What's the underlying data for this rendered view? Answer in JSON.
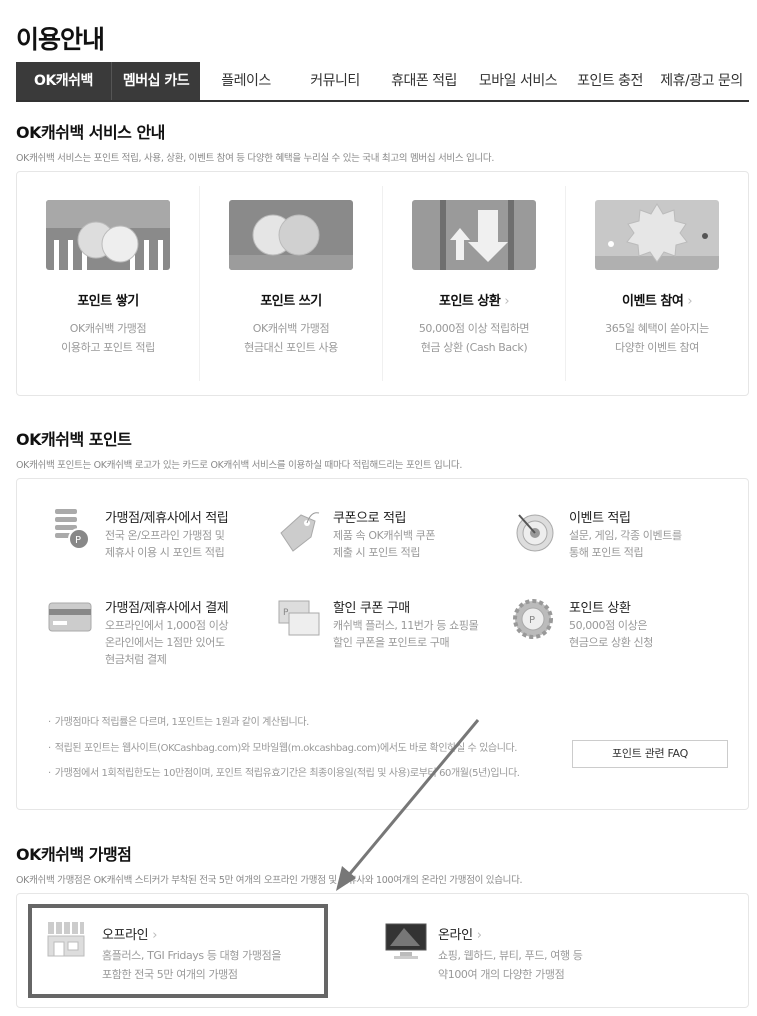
{
  "page": {
    "title": "이용안내"
  },
  "tabs": [
    {
      "label": "OK캐쉬백",
      "active": true
    },
    {
      "label": "멤버십 카드",
      "active": true
    },
    {
      "label": "플레이스",
      "active": false
    },
    {
      "label": "커뮤니티",
      "active": false
    },
    {
      "label": "휴대폰 적립",
      "active": false
    },
    {
      "label": "모바일 서비스",
      "active": false
    },
    {
      "label": "포인트 충전",
      "active": false
    },
    {
      "label": "제휴/광고 문의",
      "active": false
    }
  ],
  "service": {
    "title": "OK캐쉬백 서비스 안내",
    "desc": "OK캐쉬백 서비스는 포인트 적립, 사용, 상환, 이벤트 참여 등 다양한 혜택을 누리실 수 있는 국내 최고의 멤버십 서비스 입니다.",
    "cards": [
      {
        "name": "포인트 쌓기",
        "link": false,
        "line1": "OK캐쉬백 가맹점",
        "line2": "이용하고 포인트 적립",
        "icon": "coins-stack-icon"
      },
      {
        "name": "포인트 쓰기",
        "link": false,
        "line1": "OK캐쉬백 가맹점",
        "line2": "현금대신 포인트 사용",
        "icon": "coins-pair-icon"
      },
      {
        "name": "포인트 상환",
        "link": true,
        "line1": "50,000점 이상 적립하면",
        "line2": "현금 상환 (Cash Back)",
        "icon": "exchange-arrows-icon"
      },
      {
        "name": "이벤트 참여",
        "link": true,
        "line1": "365일 혜택이 쏟아지는",
        "line2": "다양한 이벤트 참여",
        "icon": "event-badge-icon"
      }
    ]
  },
  "points": {
    "title": "OK캐쉬백 포인트",
    "desc": "OK캐쉬백 포인트는 OK캐쉬백 로고가 있는 카드로 OK캐쉬백 서비스를 이용하실 때마다 적립해드리는 포인트 입니다.",
    "items": [
      {
        "title": "가맹점/제휴사에서 적립",
        "line1": "전국 온/오프라인 가맹점 및",
        "line2": "제휴사 이용 시 포인트 적립",
        "line3": "",
        "icon": "coin-stack-icon"
      },
      {
        "title": "쿠폰으로 적립",
        "line1": "제품 속 OK캐쉬백 쿠폰",
        "line2": "제출 시 포인트 적립",
        "line3": "",
        "icon": "coupon-tag-icon"
      },
      {
        "title": "이벤트 적립",
        "line1": "설문, 게임, 각종 이벤트를",
        "line2": "통해 포인트 적립",
        "line3": "",
        "icon": "target-icon"
      },
      {
        "title": "가맹점/제휴사에서 결제",
        "line1": "오프라인에서 1,000점 이상",
        "line2": "온라인에서는 1점만 있어도",
        "line3": "현금처럼 결제",
        "icon": "credit-card-icon"
      },
      {
        "title": "할인 쿠폰 구매",
        "line1": "캐쉬백 플러스, 11번가 등 쇼핑몰",
        "line2": "할인 쿠폰을 포인트로 구매",
        "line3": "",
        "icon": "discount-coupon-icon"
      },
      {
        "title": "포인트 상환",
        "line1": "50,000점 이상은",
        "line2": "현금으로 상환 신청",
        "line3": "",
        "icon": "point-gear-icon"
      }
    ],
    "notes": [
      "가맹점마다 적립률은 다르며, 1포인트는 1원과 같이 계산됩니다.",
      "적립된 포인트는 웹사이트(OKCashbag.com)와 모바일웹(m.okcashbag.com)에서도 바로 확인하실 수 있습니다.",
      "가맹점에서 1회적립한도는 10만점이며, 포인트 적립유효기간은 최종이용일(적립 및 사용)로부터 60개월(5년)입니다."
    ],
    "faq_label": "포인트 관련 FAQ"
  },
  "stores": {
    "title": "OK캐쉬백 가맹점",
    "desc": "OK캐쉬백 가맹점은 OK캐쉬백 스티커가 부착된 전국 5만 여개의 오프라인 가맹점 및 제휴사와 100여개의 온라인 가맹점이 있습니다.",
    "offline": {
      "title": "오프라인",
      "line1": "홈플러스, TGI Fridays 등 대형 가맹점을",
      "line2": "포함한 전국 5만 여개의 가맹점",
      "icon": "storefront-icon"
    },
    "online": {
      "title": "온라인",
      "line1": "쇼핑, 웹하드, 뷰티, 푸드, 여행 등",
      "line2": "약100여 개의 다양한 가맹점",
      "icon": "monitor-icon"
    }
  },
  "chevron": "›"
}
